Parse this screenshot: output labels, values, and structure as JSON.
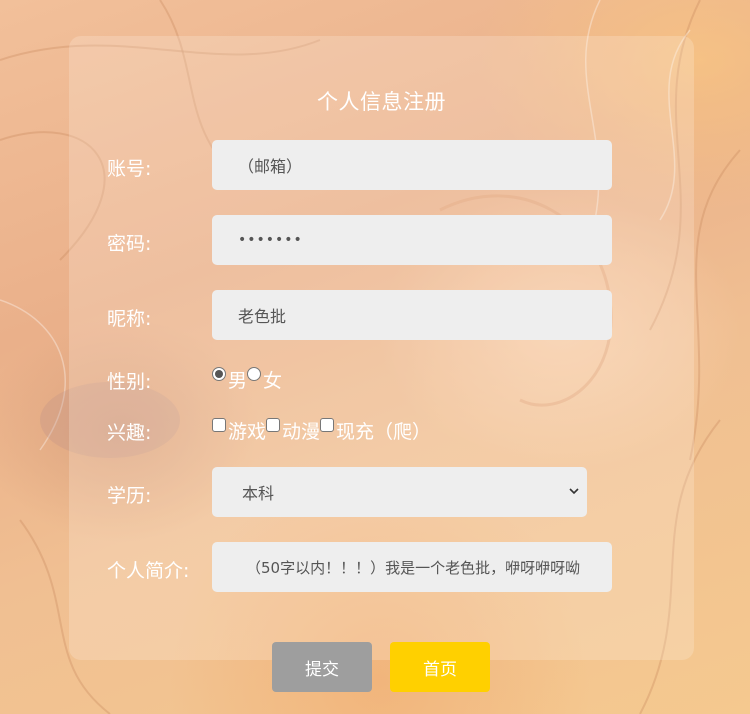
{
  "form": {
    "title": "个人信息注册",
    "account": {
      "label": "账号:",
      "value": "（邮箱）"
    },
    "password": {
      "label": "密码:",
      "value": "•••••••"
    },
    "nickname": {
      "label": "昵称:",
      "value": "老色批"
    },
    "gender": {
      "label": "性别:",
      "options": [
        {
          "label": "男",
          "checked": true
        },
        {
          "label": "女",
          "checked": false
        }
      ]
    },
    "hobbies": {
      "label": "兴趣:",
      "options": [
        {
          "label": "游戏",
          "checked": false
        },
        {
          "label": "动漫",
          "checked": false
        },
        {
          "label": "现充（爬）",
          "checked": false
        }
      ]
    },
    "education": {
      "label": "学历:",
      "selected": "本科"
    },
    "bio": {
      "label": "个人简介:",
      "value": "（50字以内！！！）我是一个老色批，咿呀咿呀呦"
    }
  },
  "buttons": {
    "submit": "提交",
    "home": "首页"
  },
  "colors": {
    "submit_bg": "#9e9e9e",
    "home_bg": "#ffd000",
    "field_bg": "#eeeeee"
  }
}
